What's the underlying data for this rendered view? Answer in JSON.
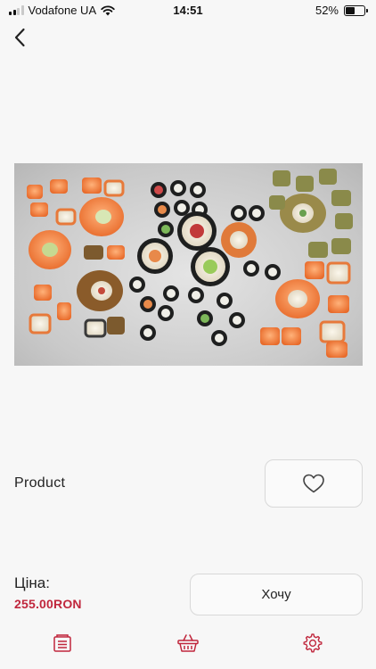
{
  "status_bar": {
    "carrier": "Vodafone UA",
    "time": "14:51",
    "battery_percent": "52%",
    "battery_level": 0.52,
    "signal_bars_filled": 2
  },
  "navigation": {
    "back_icon": "chevron-left-icon"
  },
  "product": {
    "name": "Product",
    "image_icon": "sushi-set-photo",
    "favorite_icon": "heart-outline-icon"
  },
  "pricing": {
    "label": "Ціна:",
    "value": "255.00RON"
  },
  "actions": {
    "want_label": "Хочу"
  },
  "tab_bar": {
    "items": [
      {
        "icon": "menu-list-icon"
      },
      {
        "icon": "basket-icon"
      },
      {
        "icon": "settings-gear-icon"
      }
    ]
  },
  "colors": {
    "accent": "#c0273d",
    "background": "#f7f7f7",
    "border": "#d8d8d8"
  }
}
